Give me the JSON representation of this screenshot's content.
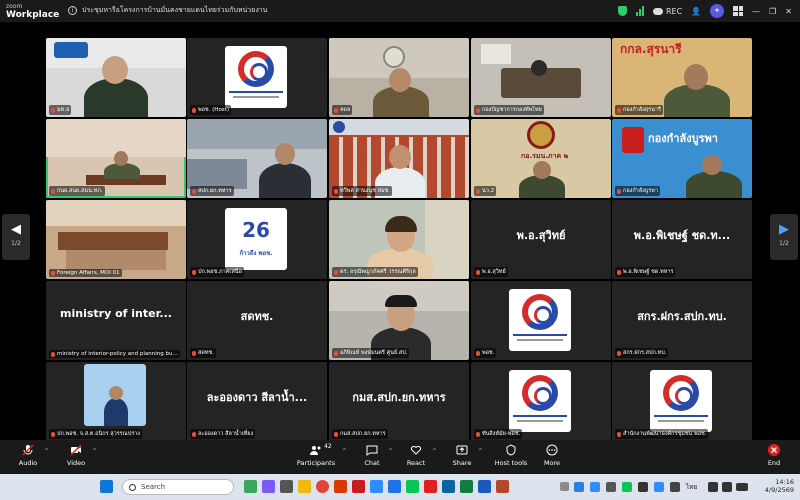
{
  "app": {
    "brand_line1": "zoom",
    "brand_line2": "Workplace",
    "meeting_title": "ประชุมหารือโครงการบ้านมั่นคงชายแดนไทยร่วมกับหน่วยงาน",
    "record_label": "REC"
  },
  "nav": {
    "left_page": "1/2",
    "right_page": "1/2"
  },
  "tiles": [
    {
      "id": "t1",
      "caption": "มท.ฮ",
      "kind": "video"
    },
    {
      "id": "t2",
      "caption": "พอช. (Host)",
      "kind": "logo"
    },
    {
      "id": "t3",
      "caption": "ลดล",
      "kind": "video"
    },
    {
      "id": "t4",
      "caption": "กองบัญชาการกองทัพไทย",
      "kind": "video"
    },
    {
      "id": "t5",
      "caption": "กองกำลังสุรนารี",
      "kind": "video",
      "overlay": "กกล.สุรนารี"
    },
    {
      "id": "t6",
      "caption": "กนผ.สนผ.สมน.ทภ.",
      "kind": "video"
    },
    {
      "id": "t7",
      "caption": "สปก.ยก.ทหาร",
      "kind": "video"
    },
    {
      "id": "t8",
      "caption": "ทวีพล สานงนุช สมช.",
      "kind": "video"
    },
    {
      "id": "t9",
      "caption": "นว.2",
      "kind": "video",
      "overlay": "กอ.รมน.ภาค ๒"
    },
    {
      "id": "t10",
      "caption": "กองกำลังบูรพา",
      "kind": "video",
      "overlay": "กองกำลังบูรพา"
    },
    {
      "id": "t11",
      "caption": "Foreign Affairs, MOI 01",
      "kind": "video"
    },
    {
      "id": "t12",
      "caption": "ปก.พอช.ภาคเหนือ",
      "kind": "logo26",
      "big_number": "26",
      "small_text": "ก้าวถึง พอช."
    },
    {
      "id": "t13",
      "caption": "ดร. อรุณีพญาภัคศรี วรรณคีรีกุล",
      "kind": "video"
    },
    {
      "id": "t14",
      "caption": "พ.อ.สุวิทย์",
      "kind": "name",
      "name": "พ.อ.สุวิทย์"
    },
    {
      "id": "t15",
      "caption": "พ.อ.พิเชษฐ์ ชด.ทหาร",
      "kind": "name",
      "name": "พ.อ.พิเชษฐ์ ชด.ท..."
    },
    {
      "id": "t16",
      "caption": "ministry of interior-policy and planning bu...",
      "kind": "name",
      "name": "ministry of inter..."
    },
    {
      "id": "t17",
      "caption": "สดทช.",
      "kind": "name",
      "name": "สดทช."
    },
    {
      "id": "t18",
      "caption": "อภิษิณท์ พงษ์มนตรี ศูนย์.สป.",
      "kind": "video"
    },
    {
      "id": "t19",
      "caption": "พอช.",
      "kind": "logo"
    },
    {
      "id": "t20",
      "caption": "สกร.ฝกร.สปก.ทบ.",
      "kind": "name",
      "name": "สกร.ฝกร.สปก.ทบ."
    },
    {
      "id": "t21",
      "caption": "ปก.พอช. จ.ส.ต.ธนิกร สุวรรณปราง",
      "kind": "video"
    },
    {
      "id": "t22",
      "caption": "ละอองดาว สีลาน้ำเที่ยง",
      "kind": "name",
      "name": "ละอองดาว สีลาน้ำ..."
    },
    {
      "id": "t23",
      "caption": "กมส.สปก.ยก.ทหาร",
      "kind": "name",
      "name": "กมส.สปก.ยก.ทหาร"
    },
    {
      "id": "t24",
      "caption": "ทันสิงห์มัย-พอช.",
      "kind": "logo"
    },
    {
      "id": "t25",
      "caption": "สำนักงานพัฒนาองค์กรชุมชน พอช.",
      "kind": "logo"
    }
  ],
  "toolbar": {
    "audio": "Audio",
    "video": "Video",
    "participants": "Participants",
    "participants_count": "42",
    "chat": "Chat",
    "react": "React",
    "share": "Share",
    "host_tools": "Host tools",
    "more": "More",
    "end": "End"
  },
  "taskbar": {
    "search_placeholder": "Search",
    "language": "ไทย",
    "time": "14:16",
    "date": "4/9/2569"
  },
  "colors": {
    "active_border": "#2ecc71",
    "end_red": "#e02020",
    "logo_red": "#d42b2b",
    "logo_blue": "#2a4aa8",
    "muted_red": "#e74c3c"
  }
}
